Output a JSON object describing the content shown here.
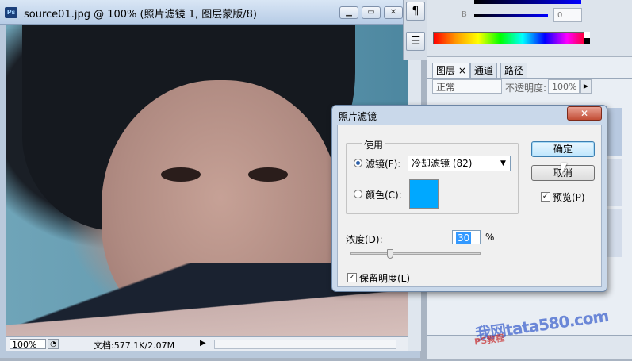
{
  "document": {
    "title": "source01.jpg @ 100% (照片滤镜 1, 图层蒙版/8)",
    "app_icon": "Ps",
    "status": {
      "zoom": "100%",
      "doc_info": "文档:577.1K/2.07M"
    }
  },
  "side_toolbar": {
    "paragraph_icon": "¶",
    "list_icon": "☰"
  },
  "color_panel": {
    "b_label": "B",
    "b_value": "0"
  },
  "layers_panel": {
    "tabs": [
      "图层",
      "通道",
      "路径"
    ],
    "blend_mode": "正常",
    "opacity_label": "不透明度:",
    "opacity_value": "100%"
  },
  "dialog": {
    "title": "照片滤镜",
    "close_label": "✕",
    "use_group_label": "使用",
    "filter_radio_label": "滤镜(F):",
    "filter_value": "冷却滤镜 (82)",
    "filter_selected": true,
    "color_radio_label": "颜色(C):",
    "color_swatch": "#00a8ff",
    "ok_label": "确定",
    "cancel_label": "取消",
    "preview_label": "预览(P)",
    "preview_checked": true,
    "density_label": "浓度(D):",
    "density_value": "30",
    "density_unit": "%",
    "density_fraction": 0.3,
    "preserve_label": "保留明度(L)",
    "preserve_checked": true
  },
  "watermark": {
    "text": "我网tata580.com",
    "sub": "PS教程"
  }
}
